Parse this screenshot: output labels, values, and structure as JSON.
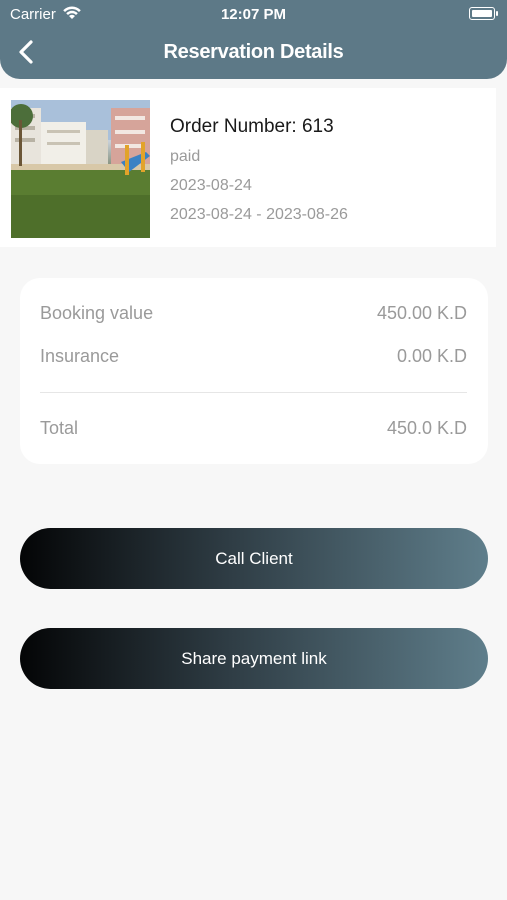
{
  "status_bar": {
    "carrier": "Carrier",
    "time": "12:07 PM"
  },
  "nav": {
    "title": "Reservation Details",
    "back_icon": "chevron-left-icon"
  },
  "order": {
    "number": "Order Number: 613",
    "status": "paid",
    "date": "2023-08-24",
    "range": "2023-08-24 - 2023-08-26"
  },
  "summary": {
    "booking_label": "Booking value",
    "booking_value": "450.00 K.D",
    "insurance_label": "Insurance",
    "insurance_value": "0.00 K.D",
    "total_label": "Total",
    "total_value": "450.0 K.D"
  },
  "actions": {
    "call_client": "Call Client",
    "share_payment": "Share payment link"
  },
  "colors": {
    "header": "#5d7987",
    "background": "#f7f7f7",
    "button_start": "#040506",
    "button_end": "#5f7e8b"
  }
}
